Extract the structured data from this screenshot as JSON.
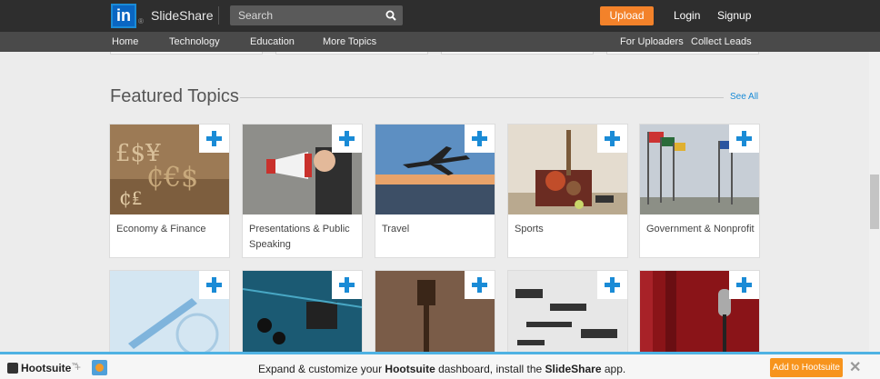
{
  "header": {
    "logo_text": "in",
    "logo_mark": "®",
    "brand": "SlideShare",
    "search_placeholder": "Search",
    "upload_label": "Upload",
    "login_label": "Login",
    "signup_label": "Signup"
  },
  "nav": {
    "left": [
      "Home",
      "Technology",
      "Education",
      "More Topics"
    ],
    "right": [
      "For Uploaders",
      "Collect Leads"
    ]
  },
  "section": {
    "title": "Featured Topics",
    "see_all": "See All"
  },
  "cards": [
    {
      "label": "Economy & Finance",
      "icon": "plus-icon"
    },
    {
      "label": "Presentations & Public Speaking",
      "icon": "plus-icon"
    },
    {
      "label": "Travel",
      "icon": "plus-icon"
    },
    {
      "label": "Sports",
      "icon": "plus-icon"
    },
    {
      "label": "Government & Nonprofit",
      "icon": "plus-icon"
    },
    {
      "label": "",
      "icon": "plus-icon"
    },
    {
      "label": "",
      "icon": "plus-icon"
    },
    {
      "label": "",
      "icon": "plus-icon"
    },
    {
      "label": "",
      "icon": "plus-icon"
    },
    {
      "label": "",
      "icon": "plus-icon"
    }
  ],
  "hootsuite": {
    "logo": "Hootsuite",
    "logo_mark": "™",
    "plus": "+",
    "message_pre": "Expand & customize your ",
    "message_brand": "Hootsuite",
    "message_mid": " dashboard, install the ",
    "message_app": "SlideShare",
    "message_post": " app.",
    "add_label": "Add to Hootsuite",
    "close": "✕"
  },
  "colors": {
    "accent": "#1a8bd6",
    "upload": "#f3822a",
    "hootsuite_button": "#f7941d",
    "hootsuite_bar_border": "#4fb2e3"
  }
}
